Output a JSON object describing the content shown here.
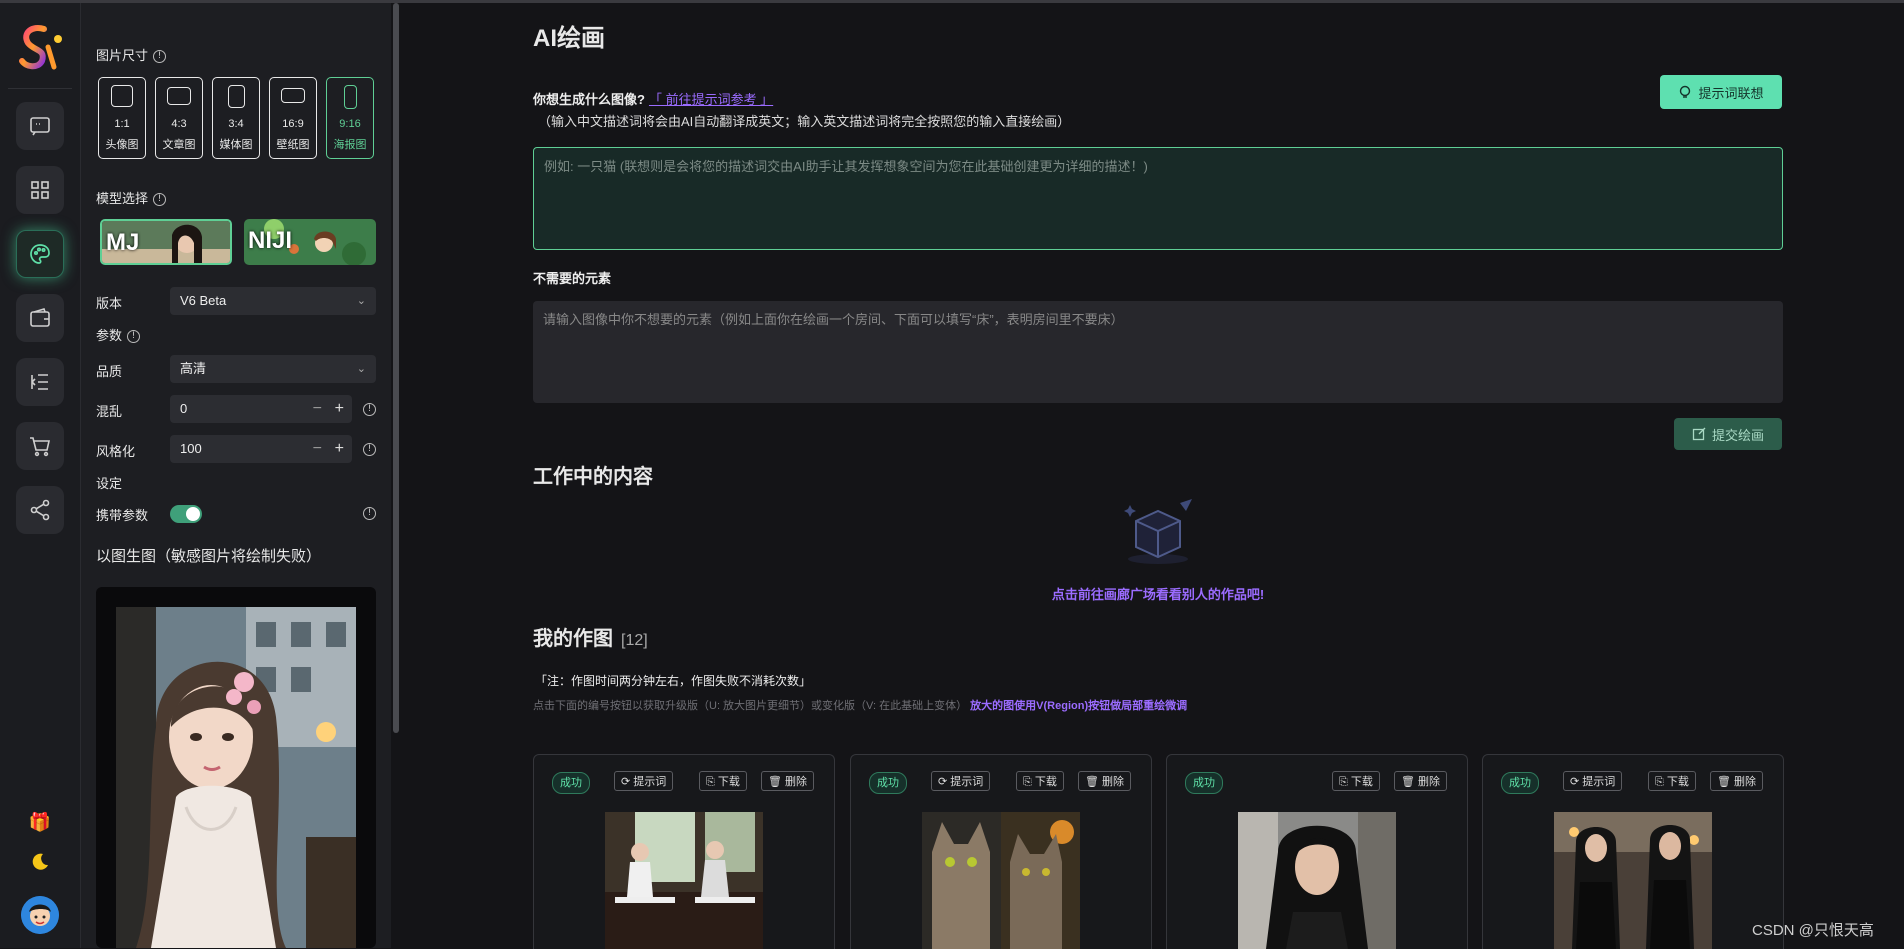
{
  "sidebar_icons": [
    "chat-icon",
    "grid-icon",
    "palette-icon",
    "wallet-icon",
    "list-icon",
    "cart-icon",
    "share-icon",
    "gift-icon",
    "moon-icon"
  ],
  "panel": {
    "image_size": {
      "label": "图片尺寸",
      "options": [
        {
          "ratio": "1:1",
          "name": "头像图"
        },
        {
          "ratio": "4:3",
          "name": "文章图"
        },
        {
          "ratio": "3:4",
          "name": "媒体图"
        },
        {
          "ratio": "16:9",
          "name": "壁纸图"
        },
        {
          "ratio": "9:16",
          "name": "海报图"
        }
      ],
      "selected": "9:16"
    },
    "model": {
      "label": "模型选择",
      "options": [
        {
          "name": "MJ"
        },
        {
          "name": "NIJI"
        }
      ],
      "selected": "MJ"
    },
    "version": {
      "label": "版本",
      "value": "V6 Beta"
    },
    "params_label": "参数",
    "quality": {
      "label": "品质",
      "value": "高清"
    },
    "chaos": {
      "label": "混乱",
      "value": "0"
    },
    "stylize": {
      "label": "风格化",
      "value": "100"
    },
    "settings_label": "设定",
    "carry_params": {
      "label": "携带参数",
      "on": true
    },
    "img2img_label": "以图生图（敏感图片将绘制失败）"
  },
  "main": {
    "title": "AI绘画",
    "question": "你想生成什么图像?",
    "prompt_ref_link": "「 前往提示词参考 」",
    "hint": "（输入中文描述词将会由AI自动翻译成英文；输入英文描述词将完全按照您的输入直接绘画）",
    "associate_btn": "提示词联想",
    "prompt_placeholder": "例如: 一只猫 (联想则是会将您的描述词交由AI助手让其发挥想象空间为您在此基础创建更为详细的描述！)",
    "negative_label": "不需要的元素",
    "negative_placeholder": "请输入图像中你不想要的元素（例如上面你在绘画一个房间、下面可以填写“床”，表明房间里不要床）",
    "submit_btn": "提交绘画",
    "working_title": "工作中的内容",
    "empty_link": "点击前往画廊广场看看别人的作品吧!",
    "my_works_title": "我的作图",
    "my_works_count": "[12]",
    "note": "「注：作图时间两分钟左右，作图失败不消耗次数」",
    "note2_prefix": "点击下面的编号按钮以获取升级版（U: 放大图片更细节）或变化版（V: 在此基础上变体）",
    "note2_highlight": "放大的图使用V(Region)按钮做局部重绘微调"
  },
  "cards": [
    {
      "status": "成功",
      "buttons": [
        "提示词",
        "下载",
        "删除"
      ],
      "subject": "piano-girls"
    },
    {
      "status": "成功",
      "buttons": [
        "提示词",
        "下载",
        "删除"
      ],
      "subject": "two-cats"
    },
    {
      "status": "成功",
      "buttons": [
        "下载",
        "删除"
      ],
      "subject": "woman-portrait"
    },
    {
      "status": "成功",
      "buttons": [
        "提示词",
        "下载",
        "删除"
      ],
      "subject": "two-women"
    }
  ],
  "watermark": "CSDN @只恨天高",
  "colors": {
    "accent": "#5fcf95",
    "link": "#9b6cff",
    "background": "#141417"
  }
}
